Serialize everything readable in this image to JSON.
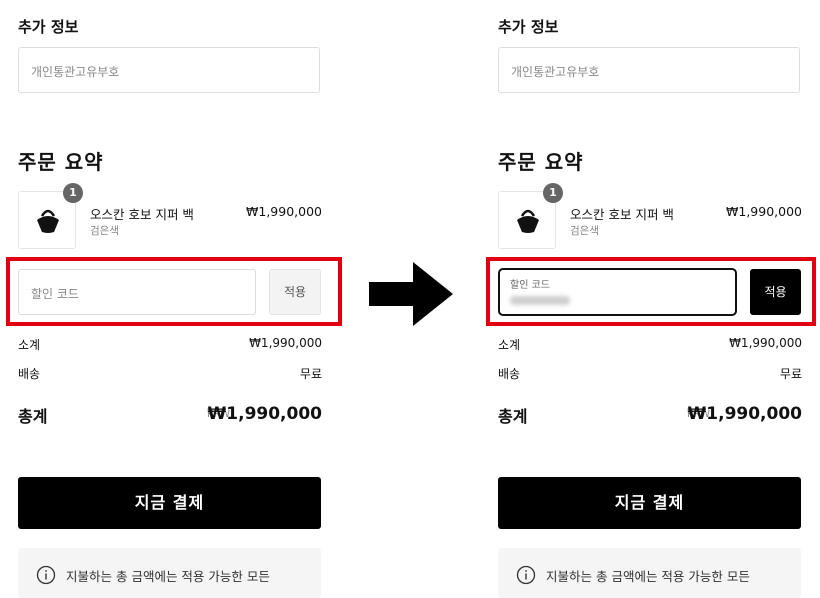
{
  "panels": {
    "left": {
      "section_title": "추가 정보",
      "customs_placeholder": "개인통관고유부호",
      "summary_title": "주문 요약",
      "item": {
        "qty": "1",
        "name": "오스칸 호보 지퍼 백",
        "color": "검은색",
        "price": "₩1,990,000"
      },
      "discount": {
        "placeholder": "할인 코드",
        "button": "적용"
      },
      "subtotal": {
        "label": "소계",
        "value": "₩1,990,000"
      },
      "shipping": {
        "label": "배송",
        "value": "무료"
      },
      "total": {
        "label": "총계",
        "currency": "KRW",
        "value": "₩1,990,000"
      },
      "pay_button": "지금 결제",
      "notice": "지불하는 총 금액에는 적용 가능한 모든"
    },
    "right": {
      "section_title": "추가 정보",
      "customs_placeholder": "개인통관고유부호",
      "summary_title": "주문 요약",
      "item": {
        "qty": "1",
        "name": "오스칸 호보 지퍼 백",
        "color": "검은색",
        "price": "₩1,990,000"
      },
      "discount": {
        "label": "할인 코드",
        "button": "적용"
      },
      "subtotal": {
        "label": "소계",
        "value": "₩1,990,000"
      },
      "shipping": {
        "label": "배송",
        "value": "무료"
      },
      "total": {
        "label": "총계",
        "currency": "KRW",
        "value": "₩1,990,000"
      },
      "pay_button": "지금 결제",
      "notice": "지불하는 총 금액에는 적용 가능한 모든"
    }
  },
  "colors": {
    "highlight": "#e00012",
    "primary": "#000000",
    "muted": "#888888"
  },
  "icons": {
    "arrow": "right-arrow-icon",
    "info": "info-icon",
    "bag": "bag-icon"
  }
}
